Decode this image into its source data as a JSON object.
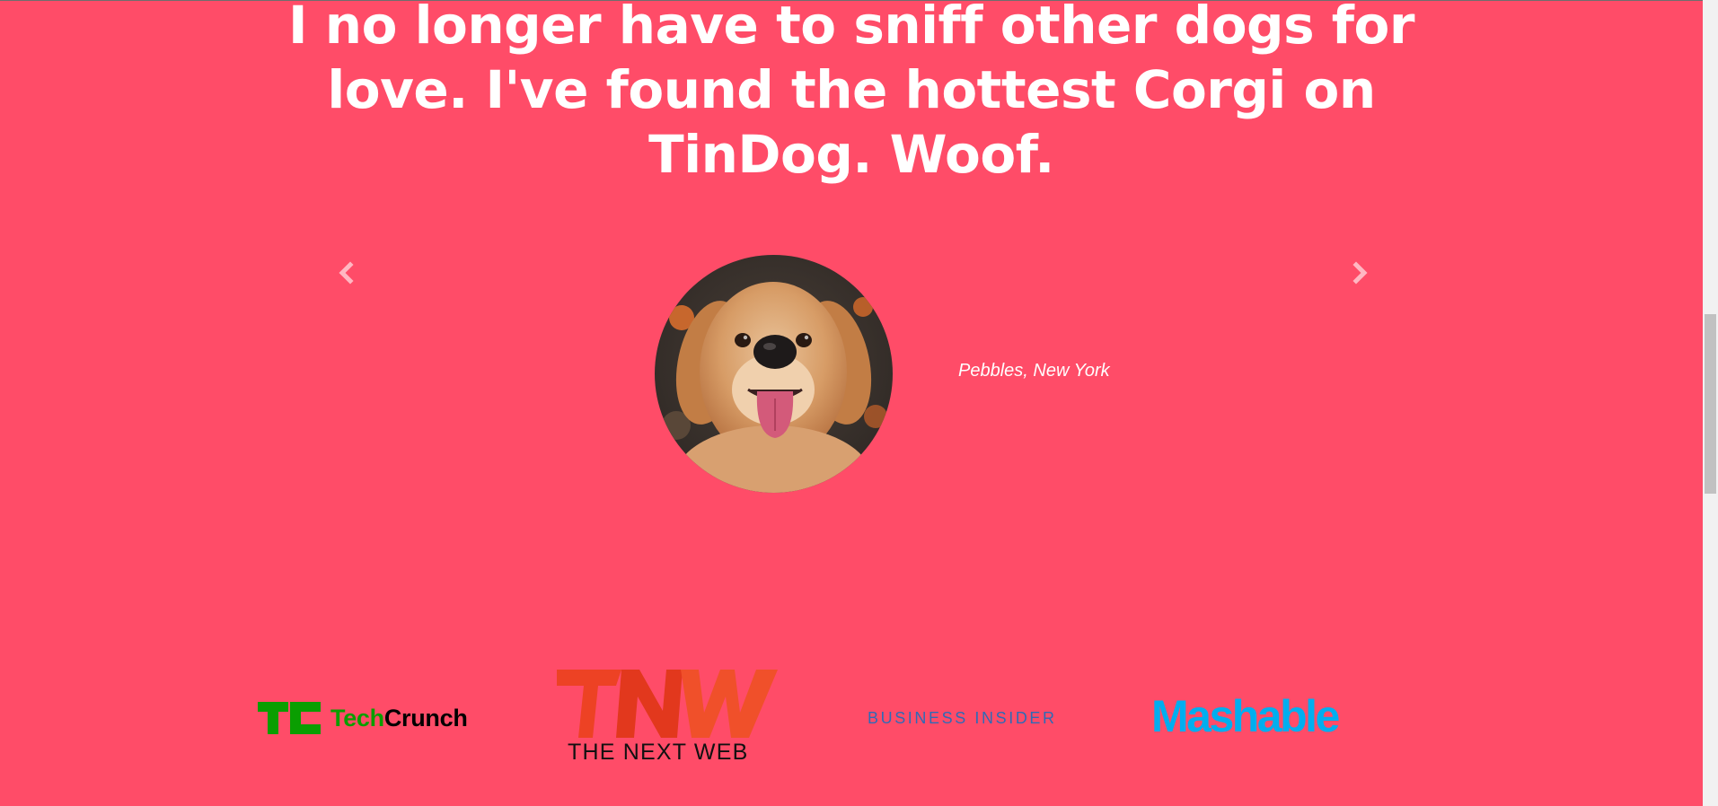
{
  "testimonial": {
    "quote": "I no longer have to sniff other dogs for love. I've found the hottest Corgi on TinDog. Woof.",
    "caption": "Pebbles, New York"
  },
  "carousel": {
    "prev_icon": "chevron-left-icon",
    "next_icon": "chevron-right-icon"
  },
  "press": {
    "techcrunch": {
      "tech": "Tech",
      "crunch": "Crunch",
      "color_tech": "#0a9e01"
    },
    "tnw": {
      "mark": "TNW",
      "name": "THE NEXT WEB",
      "color": "#ed4224"
    },
    "business_insider": {
      "name": "BUSINESS INSIDER",
      "color": "#2f6ab6"
    },
    "mashable": {
      "name": "Mashable",
      "color": "#00aeef"
    }
  },
  "colors": {
    "background": "#ff4c68",
    "text": "#ffffff"
  }
}
